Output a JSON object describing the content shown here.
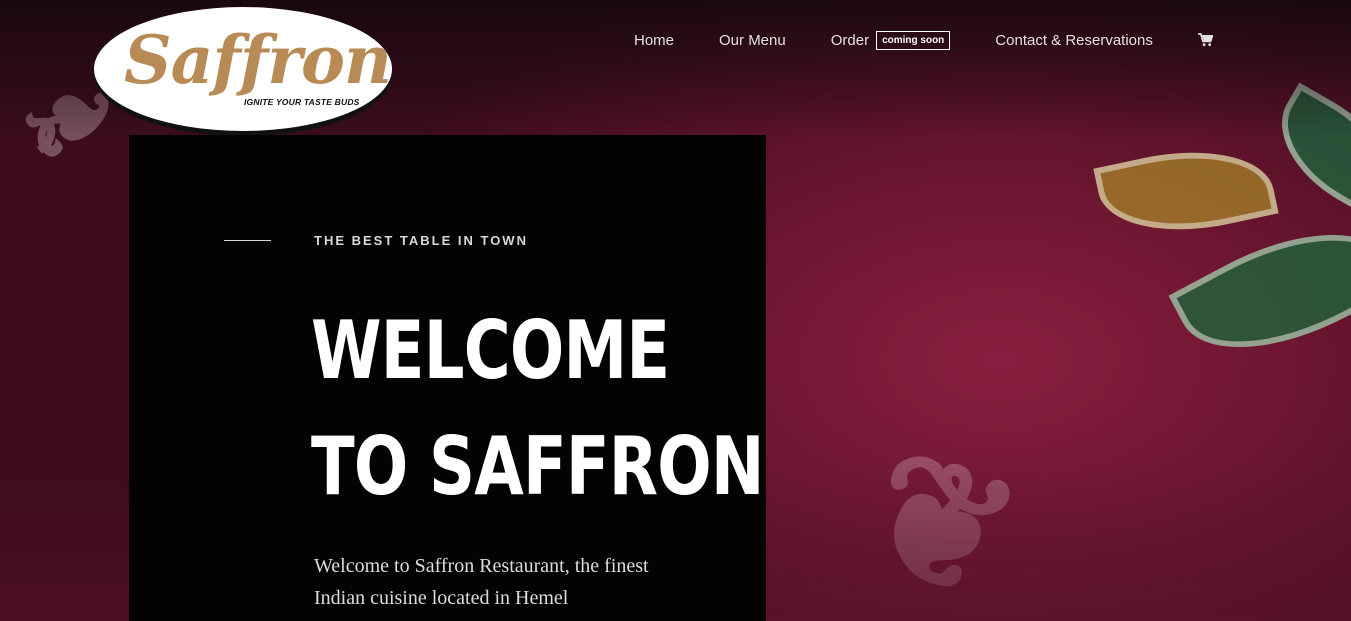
{
  "brand": {
    "name": "Saffron",
    "tagline": "IGNITE YOUR TASTE BUDS",
    "colors": {
      "gold": "#b88a55",
      "burgundy": "#6a1530",
      "card": "#030303"
    }
  },
  "nav": {
    "home": "Home",
    "menu": "Our Menu",
    "order": "Order",
    "order_badge": "coming soon",
    "contact": "Contact & Reservations",
    "cart_icon": "shopping-cart-icon"
  },
  "hero": {
    "eyebrow": "THE BEST TABLE IN TOWN",
    "headline_line1": "WELCOME",
    "headline_line2": "TO SAFFRON",
    "intro": "Welcome to Saffron Restaurant, the finest Indian cuisine located in Hemel"
  }
}
